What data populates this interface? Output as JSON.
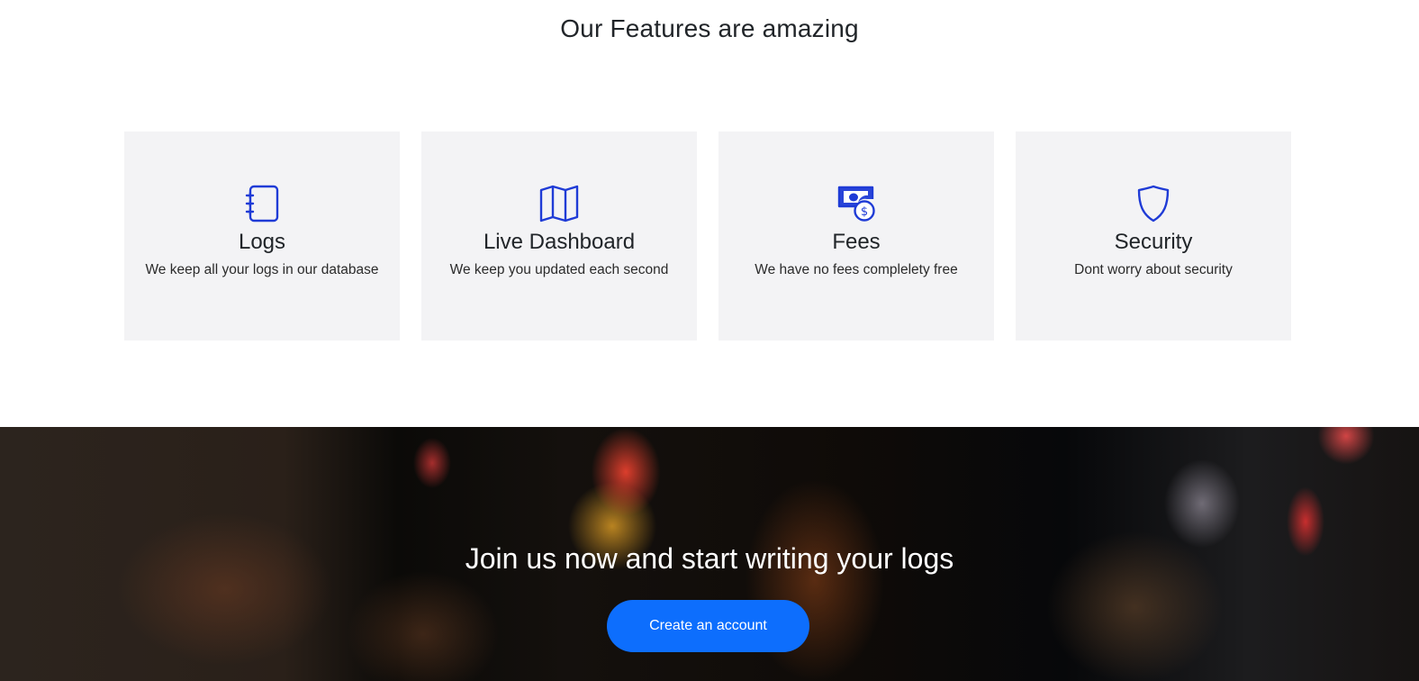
{
  "features": {
    "title": "Our Features are amazing",
    "icon_color": "#1f3bd6",
    "cards": [
      {
        "icon": "journal-icon",
        "title": "Logs",
        "description": "We keep all your logs in our database"
      },
      {
        "icon": "map-icon",
        "title": "Live Dashboard",
        "description": "We keep you updated each second"
      },
      {
        "icon": "cash-coin-icon",
        "title": "Fees",
        "description": "We have no fees complelety free"
      },
      {
        "icon": "shield-icon",
        "title": "Security",
        "description": "Dont worry about security"
      }
    ]
  },
  "cta": {
    "title": "Join us now and start writing your logs",
    "button_label": "Create an account",
    "button_color": "#0d6efd"
  }
}
